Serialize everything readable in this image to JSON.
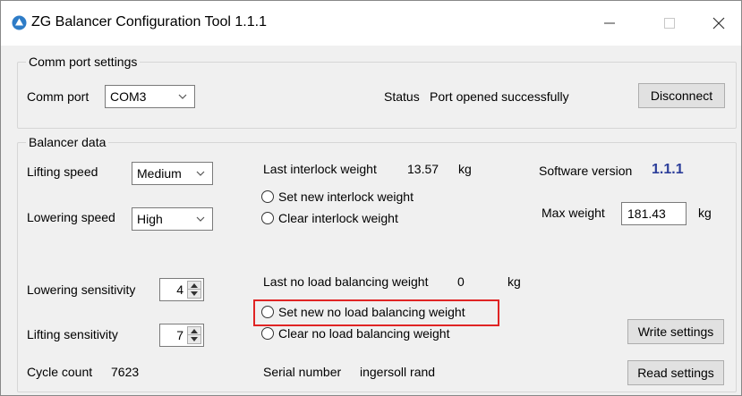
{
  "window": {
    "title": "ZG Balancer Configuration Tool 1.1.1",
    "icons": {
      "app": "app-logo-icon",
      "minimize": "minimize-icon",
      "maximize": "maximize-icon",
      "close": "close-icon"
    }
  },
  "comm": {
    "legend": "Comm port settings",
    "port_label": "Comm port",
    "port_value": "COM3",
    "status_label": "Status",
    "status_value": "Port opened successfully",
    "disconnect_label": "Disconnect"
  },
  "balancer": {
    "legend": "Balancer data",
    "lifting_speed_label": "Lifting speed",
    "lifting_speed_value": "Medium",
    "lowering_speed_label": "Lowering speed",
    "lowering_speed_value": "High",
    "last_interlock_label": "Last interlock weight",
    "last_interlock_value": "13.57",
    "last_interlock_unit": "kg",
    "set_interlock_label": "Set new interlock weight",
    "clear_interlock_label": "Clear interlock weight",
    "software_version_label": "Software version",
    "software_version_value": "1.1.1",
    "max_weight_label": "Max weight",
    "max_weight_value": "181.43",
    "max_weight_unit": "kg",
    "lowering_sensitivity_label": "Lowering sensitivity",
    "lowering_sensitivity_value": "4",
    "lifting_sensitivity_label": "Lifting sensitivity",
    "lifting_sensitivity_value": "7",
    "last_no_load_label": "Last no load balancing weight",
    "last_no_load_value": "0",
    "last_no_load_unit": "kg",
    "set_no_load_label": "Set new no load balancing weight",
    "clear_no_load_label": "Clear no load balancing weight",
    "write_settings_label": "Write settings",
    "read_settings_label": "Read settings",
    "cycle_count_label": "Cycle count",
    "cycle_count_value": "7623",
    "serial_number_label": "Serial number",
    "serial_number_value": "ingersoll rand"
  },
  "colors": {
    "highlight": "#e02424",
    "version": "#2c3e9a"
  }
}
